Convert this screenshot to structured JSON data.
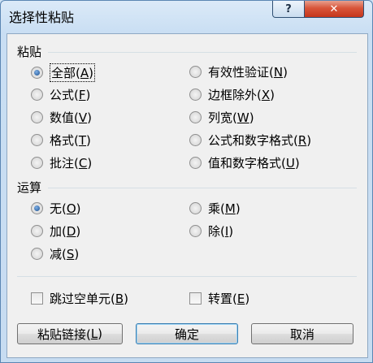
{
  "window": {
    "title": "选择性粘贴",
    "help_label": "?",
    "close_label": "✕"
  },
  "paste": {
    "label": "粘贴",
    "options": [
      {
        "text": "全部(",
        "key": "A",
        "end": ")",
        "checked": true
      },
      {
        "text": "公式(",
        "key": "F",
        "end": ")"
      },
      {
        "text": "数值(",
        "key": "V",
        "end": ")"
      },
      {
        "text": "格式(",
        "key": "T",
        "end": ")"
      },
      {
        "text": "批注(",
        "key": "C",
        "end": ")"
      },
      {
        "text": "有效性验证(",
        "key": "N",
        "end": ")"
      },
      {
        "text": "边框除外(",
        "key": "X",
        "end": ")"
      },
      {
        "text": "列宽(",
        "key": "W",
        "end": ")"
      },
      {
        "text": "公式和数字格式(",
        "key": "R",
        "end": ")"
      },
      {
        "text": "值和数字格式(",
        "key": "U",
        "end": ")"
      }
    ]
  },
  "operation": {
    "label": "运算",
    "options": [
      {
        "text": "无(",
        "key": "O",
        "end": ")",
        "checked": true
      },
      {
        "text": "加(",
        "key": "D",
        "end": ")"
      },
      {
        "text": "减(",
        "key": "S",
        "end": ")"
      },
      {
        "text": "乘(",
        "key": "M",
        "end": ")"
      },
      {
        "text": "除(",
        "key": "I",
        "end": ")"
      }
    ]
  },
  "checkboxes": {
    "skip_blanks": {
      "text": "跳过空单元(",
      "key": "B",
      "end": ")"
    },
    "transpose": {
      "text": "转置(",
      "key": "E",
      "end": ")"
    }
  },
  "buttons": {
    "paste_link": {
      "text": "粘贴链接(",
      "key": "L",
      "end": ")"
    },
    "ok": "确定",
    "cancel": "取消"
  }
}
